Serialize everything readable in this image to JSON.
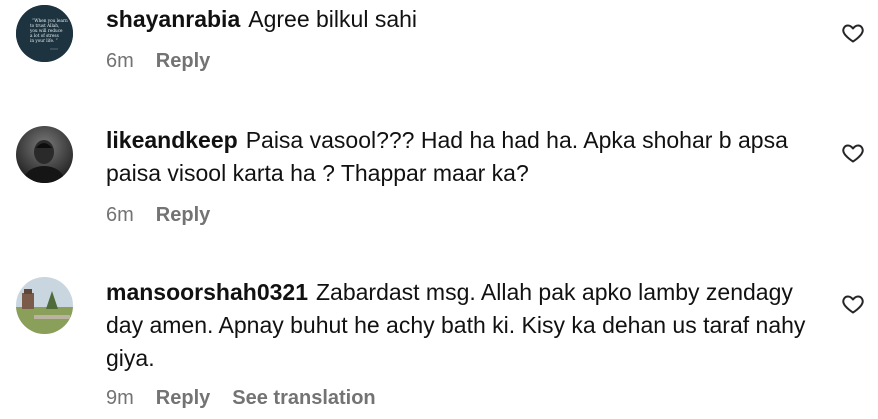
{
  "comments": [
    {
      "username": "shayanrabia",
      "text": "Agree bilkul sahi",
      "time": "6m",
      "reply_label": "Reply",
      "avatar_quote": "When you learn to trust Allah, you will reduce a lot of stress in your life."
    },
    {
      "username": "likeandkeep",
      "text": "Paisa vasool??? Had ha had ha. Apka shohar b apsa paisa visool karta ha ? Thappar maar ka?",
      "time": "6m",
      "reply_label": "Reply"
    },
    {
      "username": "mansoorshah0321",
      "text": "Zabardast msg. Allah pak apko lamby zendagy day amen. Apnay buhut he achy bath ki. Kisy ka dehan us taraf nahy giya.",
      "time": "9m",
      "reply_label": "Reply",
      "translation_label": "See translation"
    }
  ],
  "icons": {
    "like": "heart-outline-icon"
  }
}
